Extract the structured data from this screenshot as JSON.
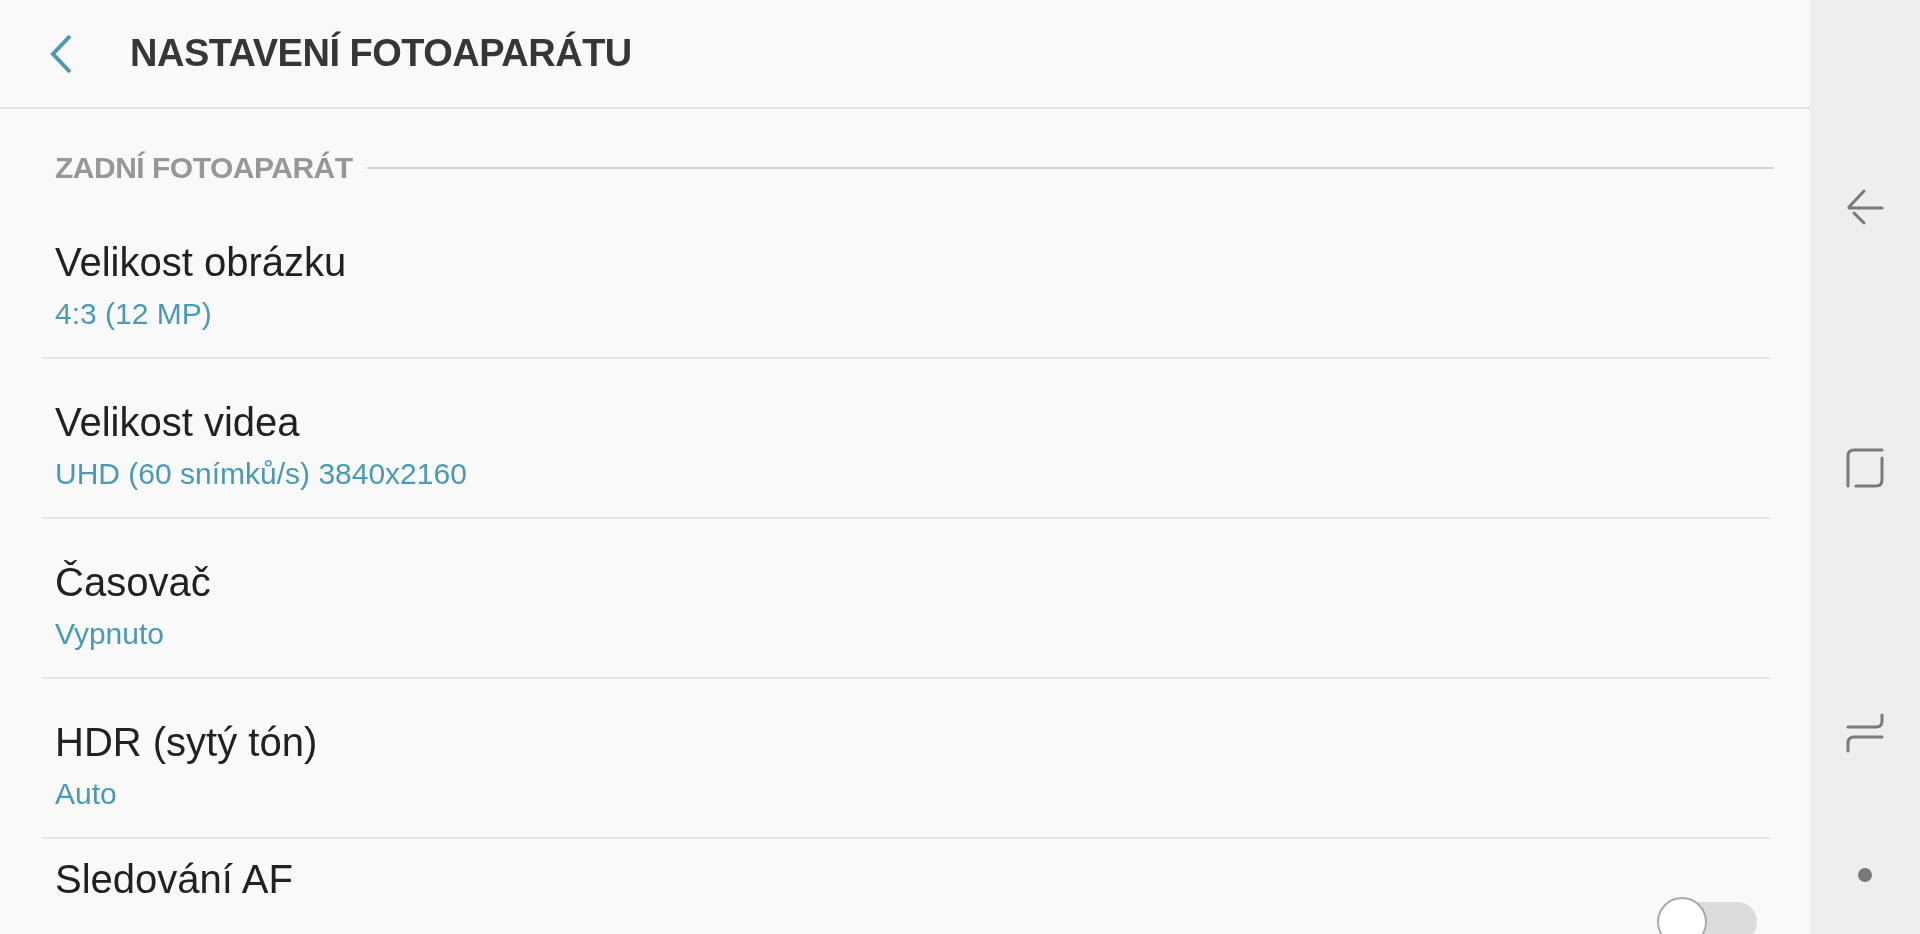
{
  "header": {
    "title": "NASTAVENÍ FOTOAPARÁTU"
  },
  "section": {
    "title": "ZADNÍ FOTOAPARÁT"
  },
  "items": [
    {
      "kind": "value",
      "title": "Velikost obrázku",
      "value": "4:3 (12 MP)"
    },
    {
      "kind": "value",
      "title": "Velikost videa",
      "value": "UHD (60 snímků/s) 3840x2160"
    },
    {
      "kind": "value",
      "title": "Časovač",
      "value": "Vypnuto"
    },
    {
      "kind": "value",
      "title": "HDR (sytý tón)",
      "value": "Auto"
    },
    {
      "kind": "switch",
      "title": "Sledování AF",
      "on": false
    }
  ]
}
